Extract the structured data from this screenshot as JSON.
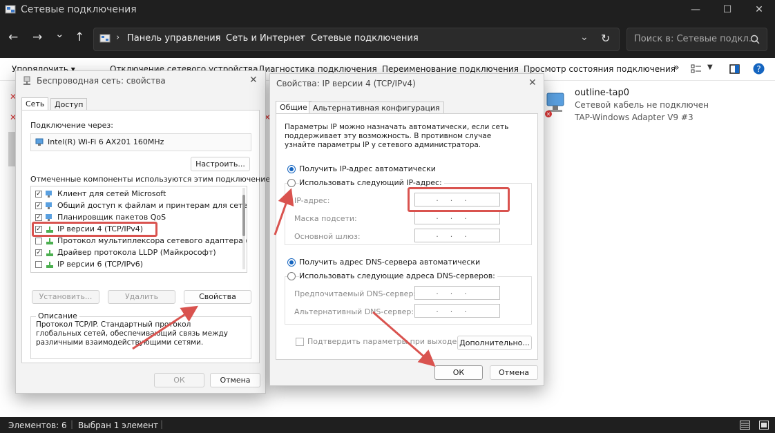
{
  "window": {
    "title": "Сетевые подключения",
    "minimize": "—",
    "maximize": "☐",
    "close": "✕"
  },
  "nav": {
    "back": "←",
    "forward": "→",
    "recent": "⌄",
    "up": "↑",
    "breadcrumbs": [
      "Панель управления",
      "Сеть и Интернет",
      "Сетевые подключения"
    ],
    "refresh": "↻",
    "search_placeholder": "Поиск в: Сетевые подкл..."
  },
  "commandbar": {
    "organize": "Упорядочить ▾",
    "items": [
      "Отключение сетевого устройства",
      "Диагностика подключения",
      "Переименование подключения",
      "Просмотр состояния подключения"
    ],
    "more": "»"
  },
  "connection": {
    "name": "outline-tap0",
    "status": "Сетевой кабель не подключен",
    "adapter": "TAP-Windows Adapter V9 #3"
  },
  "status": {
    "items": "Элементов: 6",
    "selected": "Выбран 1 элемент"
  },
  "wireless": {
    "title": "Беспроводная сеть: свойства",
    "tabs": [
      "Сеть",
      "Доступ"
    ],
    "connect_via_label": "Подключение через:",
    "adapter": "Intel(R) Wi-Fi 6 AX201 160MHz",
    "configure": "Настроить...",
    "components_label": "Отмеченные компоненты используются этим подключением:",
    "components": [
      {
        "label": "Клиент для сетей Microsoft",
        "checked": true
      },
      {
        "label": "Общий доступ к файлам и принтерам для сетей Mi",
        "checked": true
      },
      {
        "label": "Планировщик пакетов QoS",
        "checked": true
      },
      {
        "label": "IP версии 4 (TCP/IPv4)",
        "checked": true
      },
      {
        "label": "Протокол мультиплексора сетевого адаптера (Ма",
        "checked": false
      },
      {
        "label": "Драйвер протокола LLDP (Майкрософт)",
        "checked": true
      },
      {
        "label": "IP версии 6 (TCP/IPv6)",
        "checked": false
      }
    ],
    "install": "Установить...",
    "remove": "Удалить",
    "properties": "Свойства",
    "description_title": "Описание",
    "description": "Протокол TCP/IP. Стандартный протокол глобальных сетей, обеспечивающий связь между различными взаимодействующими сетями.",
    "ok": "ОК",
    "cancel": "Отмена"
  },
  "ipv4": {
    "title": "Свойства: IP версии 4 (TCP/IPv4)",
    "tabs": [
      "Общие",
      "Альтернативная конфигурация"
    ],
    "intro": "Параметры IP можно назначать автоматически, если сеть поддерживает эту возможность. В противном случае узнайте параметры IP у сетевого администратора.",
    "auto_ip": "Получить IP-адрес автоматически",
    "manual_ip": "Использовать следующий IP-адрес:",
    "ip_label": "IP-адрес:",
    "mask_label": "Маска подсети:",
    "gateway_label": "Основной шлюз:",
    "auto_dns": "Получить адрес DNS-сервера автоматически",
    "manual_dns": "Использовать следующие адреса DNS-серверов:",
    "pref_dns_label": "Предпочитаемый DNS-сервер:",
    "alt_dns_label": "Альтернативный DNS-сервер:",
    "ip_dots": "...",
    "validate": "Подтвердить параметры при выходе",
    "advanced": "Дополнительно...",
    "ok": "ОК",
    "cancel": "Отмена"
  },
  "colors": {
    "dark_chrome": "#1f1f1f",
    "accent": "#1565c0",
    "annotation_red": "#d9534f"
  }
}
